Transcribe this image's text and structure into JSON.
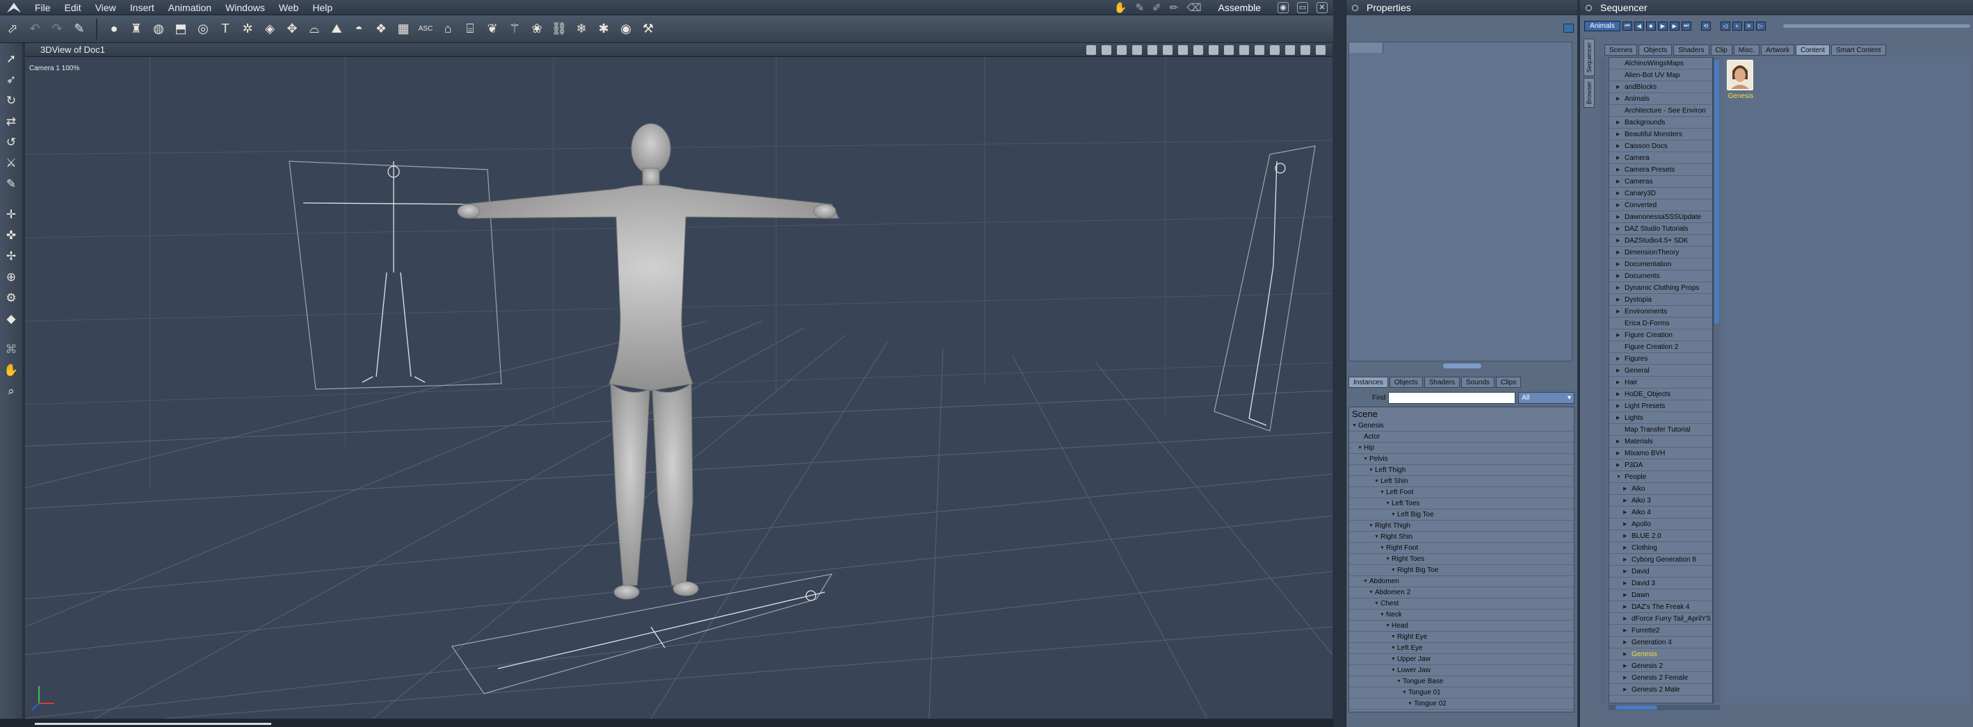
{
  "menubar": {
    "items": [
      "File",
      "Edit",
      "View",
      "Insert",
      "Animation",
      "Windows",
      "Web",
      "Help"
    ],
    "layout_tab": "Assemble"
  },
  "viewport": {
    "title": "3DView of Doc1",
    "camera_label": "Camera 1  100%"
  },
  "properties": {
    "title": "Properties",
    "tabs": [
      "Instances",
      "Objects",
      "Shaders",
      "Sounds",
      "Clips"
    ],
    "find_label": "Find",
    "find_value": "",
    "filter_value": "All",
    "scene_label": "Scene",
    "tree": [
      {
        "label": "Genesis",
        "level": 0
      },
      {
        "label": "Actor",
        "level": 1
      },
      {
        "label": "Hip",
        "level": 1
      },
      {
        "label": "Pelvis",
        "level": 2
      },
      {
        "label": "Left Thigh",
        "level": 3
      },
      {
        "label": "Left Shin",
        "level": 4
      },
      {
        "label": "Left Foot",
        "level": 5
      },
      {
        "label": "Left Toes",
        "level": 6
      },
      {
        "label": "Left Big Toe",
        "level": 7
      },
      {
        "label": "Right Thigh",
        "level": 3
      },
      {
        "label": "Right Shin",
        "level": 4
      },
      {
        "label": "Right Foot",
        "level": 5
      },
      {
        "label": "Right Toes",
        "level": 6
      },
      {
        "label": "Right Big Toe",
        "level": 7
      },
      {
        "label": "Abdomen",
        "level": 2
      },
      {
        "label": "Abdomen 2",
        "level": 3
      },
      {
        "label": "Chest",
        "level": 4
      },
      {
        "label": "Neck",
        "level": 5
      },
      {
        "label": "Head",
        "level": 6
      },
      {
        "label": "Right Eye",
        "level": 7
      },
      {
        "label": "Left Eye",
        "level": 7
      },
      {
        "label": "Upper Jaw",
        "level": 7
      },
      {
        "label": "Lower Jaw",
        "level": 7
      },
      {
        "label": "Tongue Base",
        "level": 8
      },
      {
        "label": "Tongue 01",
        "level": 9
      },
      {
        "label": "Tongue 02",
        "level": 10
      }
    ]
  },
  "sequencer": {
    "title": "Sequencer",
    "animals_button": "Animals",
    "side_tabs": [
      "Sequencer",
      "Browser"
    ],
    "content_tabs": [
      "Scenes",
      "Objects",
      "Shaders",
      "Clip",
      "Misc.",
      "Artwork",
      "Content",
      "Smart Content"
    ],
    "browser_items": [
      {
        "label": "AlchinoWingsMaps",
        "arrow": false
      },
      {
        "label": "Alien-Bot UV Map",
        "arrow": false
      },
      {
        "label": "andBlocks",
        "arrow": true
      },
      {
        "label": "Animals",
        "arrow": true
      },
      {
        "label": "Architecture - See Environ",
        "arrow": false
      },
      {
        "label": "Backgrounds",
        "arrow": true
      },
      {
        "label": "Beautiful Monsters",
        "arrow": true
      },
      {
        "label": "Caisson Docs",
        "arrow": true
      },
      {
        "label": "Camera",
        "arrow": true
      },
      {
        "label": "Camera Presets",
        "arrow": true
      },
      {
        "label": "Cameras",
        "arrow": true
      },
      {
        "label": "Canary3D",
        "arrow": true
      },
      {
        "label": "Converted",
        "arrow": true
      },
      {
        "label": "DawnonessaSSSUpdate",
        "arrow": true
      },
      {
        "label": "DAZ Studio Tutorials",
        "arrow": true
      },
      {
        "label": "DAZStudio4.5+ SDK",
        "arrow": true
      },
      {
        "label": "DimensionTheory",
        "arrow": true
      },
      {
        "label": "Documentation",
        "arrow": true
      },
      {
        "label": "Documents",
        "arrow": true
      },
      {
        "label": "Dynamic Clothing Props",
        "arrow": true
      },
      {
        "label": "Dystopia",
        "arrow": true
      },
      {
        "label": "Environments",
        "arrow": true
      },
      {
        "label": "Erica D-Forms",
        "arrow": false
      },
      {
        "label": "Figure Creation",
        "arrow": true
      },
      {
        "label": "Figure Creation 2",
        "arrow": false
      },
      {
        "label": "Figures",
        "arrow": true
      },
      {
        "label": "General",
        "arrow": true
      },
      {
        "label": "Hair",
        "arrow": true
      },
      {
        "label": "HoDE_Objects",
        "arrow": true
      },
      {
        "label": "Light Presets",
        "arrow": true
      },
      {
        "label": "Lights",
        "arrow": true
      },
      {
        "label": "Map Transfer Tutorial",
        "arrow": false
      },
      {
        "label": "Materials",
        "arrow": true
      },
      {
        "label": "Mixamo BVH",
        "arrow": true
      },
      {
        "label": "P3DA",
        "arrow": true
      },
      {
        "label": "People",
        "arrow": true,
        "open": true
      },
      {
        "label": "Aiko",
        "arrow": true,
        "child": true
      },
      {
        "label": "Aiko 3",
        "arrow": true,
        "child": true
      },
      {
        "label": "Aiko 4",
        "arrow": true,
        "child": true
      },
      {
        "label": "Apollo",
        "arrow": true,
        "child": true
      },
      {
        "label": "BLUE 2.0",
        "arrow": true,
        "child": true
      },
      {
        "label": "Clothing",
        "arrow": true,
        "child": true
      },
      {
        "label": "Cyborg Generation 8",
        "arrow": true,
        "child": true
      },
      {
        "label": "David",
        "arrow": true,
        "child": true
      },
      {
        "label": "David 3",
        "arrow": true,
        "child": true
      },
      {
        "label": "Dawn",
        "arrow": true,
        "child": true
      },
      {
        "label": "DAZ's The Freak 4",
        "arrow": true,
        "child": true
      },
      {
        "label": "dForce Furry Tail_AprilYS",
        "arrow": true,
        "child": true
      },
      {
        "label": "Furrette2",
        "arrow": true,
        "child": true
      },
      {
        "label": "Generation 4",
        "arrow": true,
        "child": true
      },
      {
        "label": "Genesis",
        "arrow": true,
        "child": true,
        "selected": true
      },
      {
        "label": "Genesis 2",
        "arrow": true,
        "child": true
      },
      {
        "label": "Genesis 2 Female",
        "arrow": true,
        "child": true
      },
      {
        "label": "Genesis 2 Male",
        "arrow": true,
        "child": true
      }
    ],
    "thumbnail_label": "Genesis"
  },
  "colors": {
    "annotation": "#c424e0",
    "selected_text": "#f1df3a",
    "viewport_bg": "#394556"
  }
}
